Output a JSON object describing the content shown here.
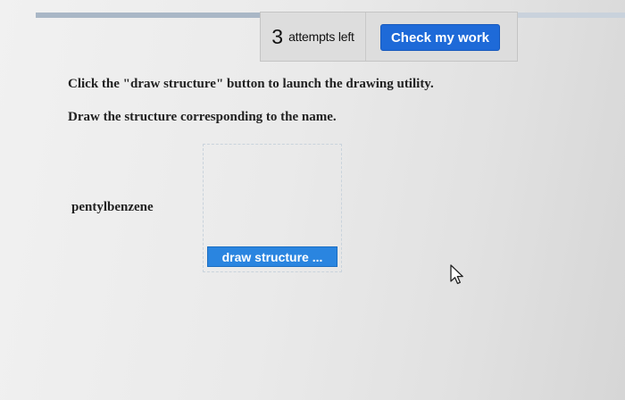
{
  "header": {
    "attempts_count": "3",
    "attempts_label": "attempts left",
    "check_button_label": "Check my work"
  },
  "question": {
    "instruction_1": "Click the \"draw structure\" button to launch the drawing utility.",
    "instruction_2": "Draw the structure corresponding to the name.",
    "compound_name": "pentylbenzene",
    "draw_button_label": "draw structure ..."
  },
  "colors": {
    "primary_button": "#1e6ad8",
    "draw_button": "#2a85e0"
  },
  "icons": {
    "cursor": "mouse-pointer-icon"
  }
}
